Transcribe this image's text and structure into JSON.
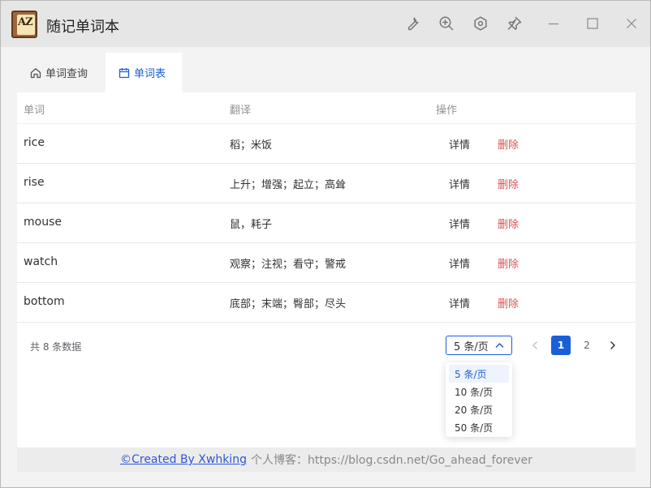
{
  "app": {
    "title": "随记单词本"
  },
  "tabs": [
    {
      "label": "单词查询"
    },
    {
      "label": "单词表"
    }
  ],
  "table": {
    "headers": {
      "word": "单词",
      "translation": "翻译",
      "action": "操作"
    },
    "rows": [
      {
        "word": "rice",
        "translation": "稻；米饭",
        "detail": "详情",
        "delete": "删除"
      },
      {
        "word": "rise",
        "translation": "上升；增强；起立；高耸",
        "detail": "详情",
        "delete": "删除"
      },
      {
        "word": "mouse",
        "translation": "鼠，耗子",
        "detail": "详情",
        "delete": "删除"
      },
      {
        "word": "watch",
        "translation": "观察；注视；看守；警戒",
        "detail": "详情",
        "delete": "删除"
      },
      {
        "word": "bottom",
        "translation": "底部；末端；臀部；尽头",
        "detail": "详情",
        "delete": "删除"
      }
    ]
  },
  "pagination": {
    "total": "共 8 条数据",
    "page_size": "5 条/页",
    "pages": [
      "1",
      "2"
    ],
    "current_page": "1",
    "size_options": [
      "5 条/页",
      "10 条/页",
      "20 条/页",
      "50 条/页"
    ]
  },
  "footer": {
    "created_by": "©Created By Xwhking",
    "blog": "个人博客：https://blog.csdn.net/Go_ahead_forever"
  },
  "colors": {
    "accent": "#1a5fd7",
    "delete": "#d9534f",
    "link": "#2c58d6"
  }
}
